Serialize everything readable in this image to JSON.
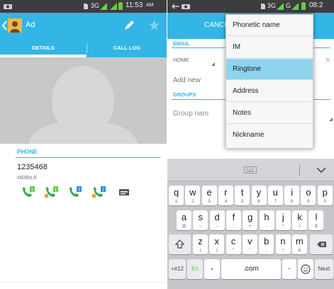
{
  "left": {
    "status": {
      "network": "3G",
      "time": "11:53",
      "ampm": "AM"
    },
    "header": {
      "title": "Ad"
    },
    "tabs": [
      "DETAILS",
      "CALL LOG"
    ],
    "phone": {
      "section": "PHONE",
      "number": "1235468",
      "type": "MOBILE"
    },
    "action_icons": [
      "call-sim1-icon",
      "message-sim1-icon",
      "call-sim2-icon",
      "message-sim2-icon",
      "sms-icon"
    ]
  },
  "right": {
    "status": {
      "network": "3G",
      "network2": "G",
      "time": "08:2"
    },
    "header": {
      "cancel": "CANCE"
    },
    "form": {
      "email_header": "EMAIL",
      "home_label": "HOME",
      "add_new": "Add new",
      "groups_header": "GROUPS",
      "group_name": "Group nam"
    },
    "menu": {
      "items": [
        "Phonetic name",
        "IM",
        "Ringtone",
        "Address",
        "Notes",
        "Nickname"
      ],
      "selected": "Ringtone"
    },
    "keyboard": {
      "row1": [
        {
          "k": "q",
          "s": "1"
        },
        {
          "k": "w",
          "s": "2"
        },
        {
          "k": "e",
          "s": "3"
        },
        {
          "k": "r",
          "s": "4"
        },
        {
          "k": "t",
          "s": "5"
        },
        {
          "k": "y",
          "s": "6"
        },
        {
          "k": "u",
          "s": "7"
        },
        {
          "k": "i",
          "s": "8"
        },
        {
          "k": "o",
          "s": "9"
        },
        {
          "k": "p",
          "s": "0"
        }
      ],
      "row2": [
        {
          "k": "a",
          "s": "@"
        },
        {
          "k": "s",
          "s": "~"
        },
        {
          "k": "d",
          "s": "-"
        },
        {
          "k": "f",
          "s": ";"
        },
        {
          "k": "g",
          "s": "+"
        },
        {
          "k": "h",
          "s": "-"
        },
        {
          "k": "j",
          "s": "*"
        },
        {
          "k": "k",
          "s": "/"
        },
        {
          "k": "l",
          "s": "$"
        }
      ],
      "row3": [
        {
          "k": "z",
          "s": "("
        },
        {
          "k": "x",
          "s": ")"
        },
        {
          "k": "c",
          "s": "\""
        },
        {
          "k": "v",
          "s": "'"
        },
        {
          "k": "b",
          "s": ":"
        },
        {
          "k": "n",
          "s": "!"
        },
        {
          "k": "m",
          "s": "&"
        }
      ],
      "bottom": {
        "symbols": "+#12",
        "lang": "En",
        "comma": ",",
        "dotcom": ".com",
        "period": ".",
        "next": "Next"
      }
    }
  },
  "colors": {
    "accent": "#33b5e5",
    "statusbar": "#3d3d3d",
    "menu_selected": "#8fd3ee",
    "signal_green": "#66cc44"
  }
}
